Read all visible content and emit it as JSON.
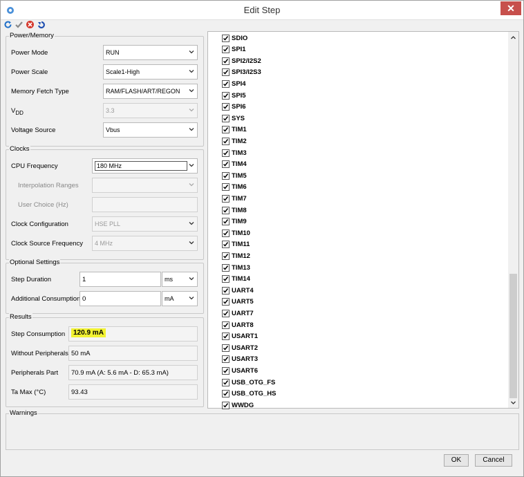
{
  "window": {
    "title": "Edit Step",
    "close_glyph": "✕"
  },
  "toolbar": {
    "icons": [
      "refresh-icon",
      "check-icon",
      "cancel-icon",
      "undo-icon"
    ]
  },
  "power": {
    "group_label": "Power/Memory",
    "power_mode": {
      "label": "Power Mode",
      "value": "RUN"
    },
    "power_scale": {
      "label": "Power Scale",
      "value": "Scale1-High"
    },
    "memory_fetch": {
      "label": "Memory Fetch Type",
      "value": "RAM/FLASH/ART/REGON"
    },
    "vdd": {
      "label": "V",
      "sub": "DD",
      "value": "3.3"
    },
    "voltage_source": {
      "label": "Voltage Source",
      "value": "Vbus"
    }
  },
  "clocks": {
    "group_label": "Clocks",
    "cpu_freq": {
      "label": "CPU Frequency",
      "value": "180 MHz"
    },
    "interp": {
      "label": "Interpolation Ranges",
      "value": ""
    },
    "user_choice": {
      "label": "User Choice (Hz)",
      "value": ""
    },
    "clock_config": {
      "label": "Clock Configuration",
      "value": "HSE PLL"
    },
    "clock_source": {
      "label": "Clock Source Frequency",
      "value": "4 MHz"
    }
  },
  "optional": {
    "group_label": "Optional Settings",
    "step_duration": {
      "label": "Step Duration",
      "value": "1",
      "unit": "ms"
    },
    "additional": {
      "label": "Additional Consumption",
      "value": "0",
      "unit": "mA"
    }
  },
  "results": {
    "group_label": "Results",
    "step_consumption": {
      "label": "Step Consumption",
      "value": "120.9 mA"
    },
    "without_peripherals": {
      "label": "Without Peripherals",
      "value": "50 mA"
    },
    "peripherals_part": {
      "label": "Peripherals Part",
      "value": "70.9 mA  (A: 5.6 mA - D: 65.3 mA)"
    },
    "ta_max": {
      "label": "Ta Max (°C)",
      "value": "93.43"
    }
  },
  "peripherals": [
    "SDIO",
    "SPI1",
    "SPI2/I2S2",
    "SPI3/I2S3",
    "SPI4",
    "SPI5",
    "SPI6",
    "SYS",
    "TIM1",
    "TIM2",
    "TIM3",
    "TIM4",
    "TIM5",
    "TIM6",
    "TIM7",
    "TIM8",
    "TIM9",
    "TIM10",
    "TIM11",
    "TIM12",
    "TIM13",
    "TIM14",
    "UART4",
    "UART5",
    "UART7",
    "UART8",
    "USART1",
    "USART2",
    "USART3",
    "USART6",
    "USB_OTG_FS",
    "USB_OTG_HS",
    "WWDG"
  ],
  "warnings": {
    "group_label": "Warnings"
  },
  "buttons": {
    "ok": "OK",
    "cancel": "Cancel"
  },
  "colors": {
    "highlight": "#f2f232",
    "close": "#c7504c"
  }
}
